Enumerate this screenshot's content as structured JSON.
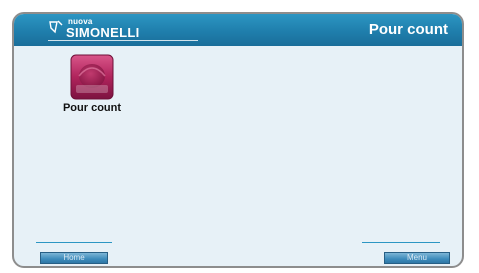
{
  "header": {
    "brand_top": "nuova",
    "brand_main": "SIMONELLI",
    "title": "Pour count"
  },
  "tiles": [
    {
      "label": "Pour count",
      "icon": "pour-count-icon",
      "color": "#b0245c"
    }
  ],
  "footer": {
    "home_label": "Home",
    "menu_label": "Menu"
  },
  "colors": {
    "header": "#1f7eac",
    "background": "#e7f1f7",
    "accent": "#2c96c3"
  }
}
